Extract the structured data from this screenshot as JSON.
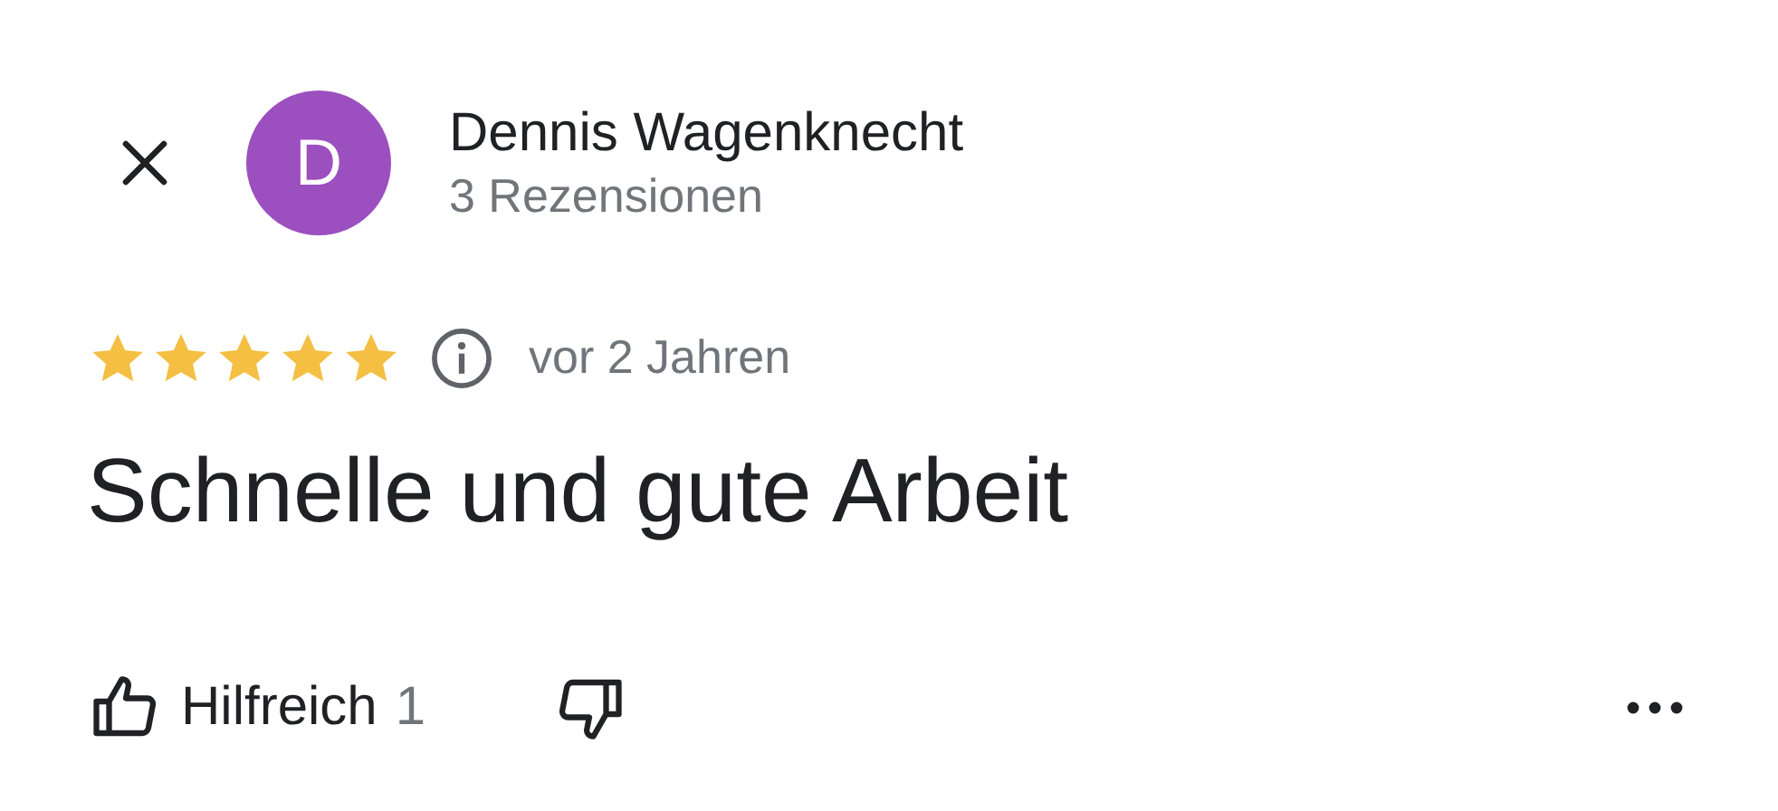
{
  "reviewer": {
    "initial": "D",
    "name": "Dennis Wagenknecht",
    "reviews": "3 Rezensionen"
  },
  "rating": {
    "stars": 5
  },
  "time": "vor 2 Jahren",
  "text": "Schnelle und gute Arbeit",
  "actions": {
    "helpful_label": "Hilfreich",
    "helpful_count": "1"
  }
}
